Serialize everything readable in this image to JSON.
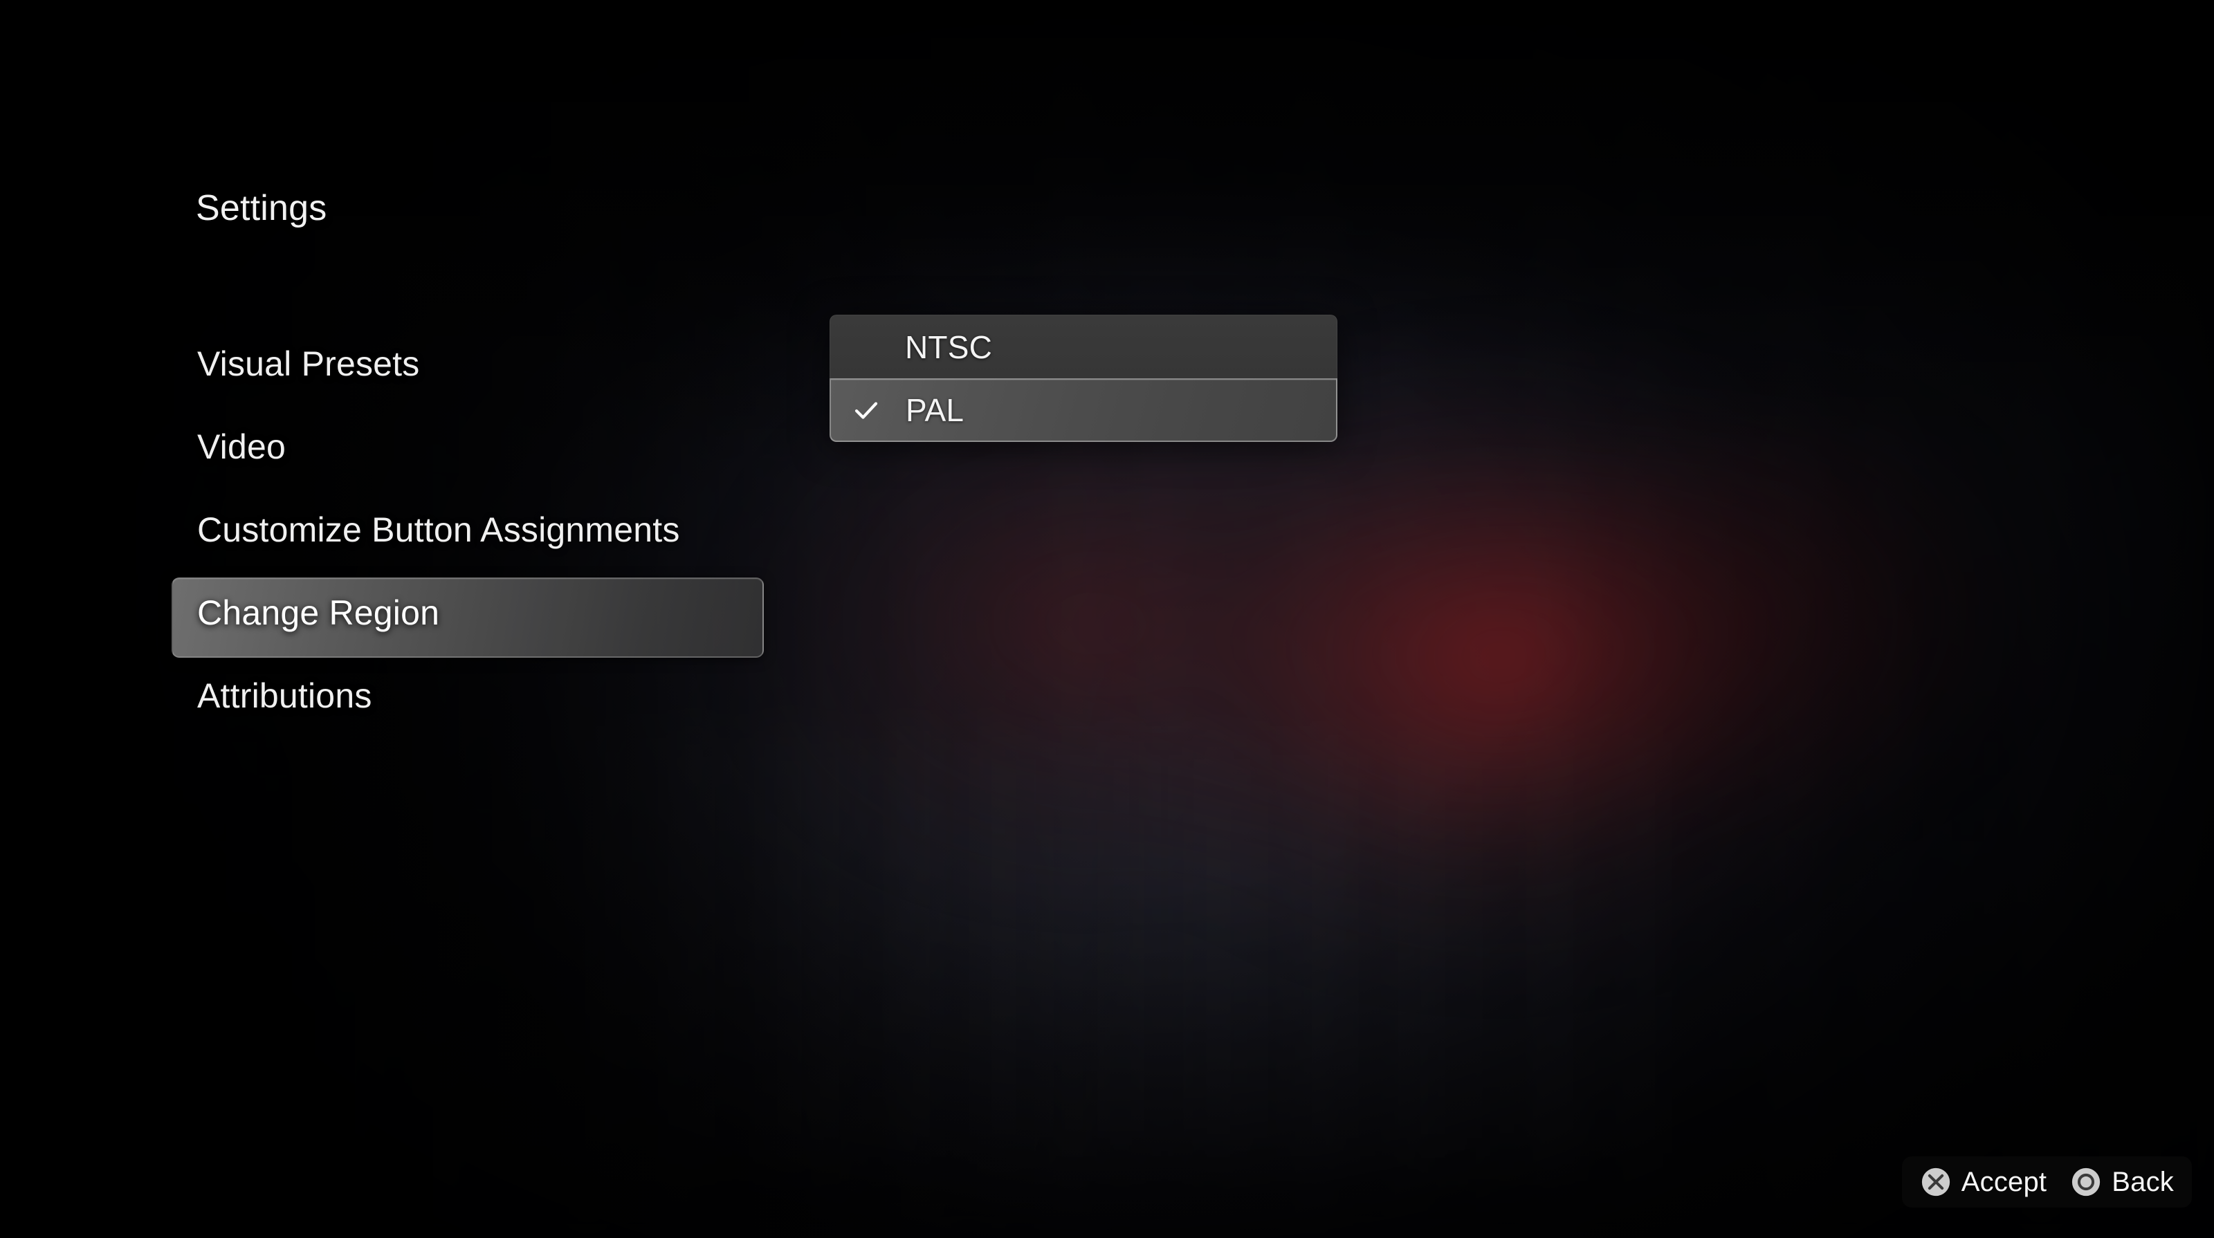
{
  "screen": {
    "title": "Settings",
    "background_description": "blurred dark game scene with red glow"
  },
  "colors": {
    "background": "#07070a",
    "red_glow": "#7a1616",
    "text_primary": "#f0f0f0",
    "selected_row_bg": "#6e6e6e",
    "dropdown_row_bg": "#363636",
    "dropdown_active_bg": "#4c4c4c",
    "prompt_bar_bg": "#080808",
    "prompt_icon_fill": "#c9c9c9"
  },
  "menu": {
    "items": [
      {
        "label": "Visual Presets",
        "selected": false
      },
      {
        "label": "Video",
        "selected": false
      },
      {
        "label": "Customize Button Assignments",
        "selected": false
      },
      {
        "label": "Change Region",
        "selected": true
      },
      {
        "label": "Attributions",
        "selected": false
      }
    ]
  },
  "dropdown": {
    "name": "Change Region",
    "selected_value": "PAL",
    "options": [
      {
        "label": "NTSC",
        "checked": false
      },
      {
        "label": "PAL",
        "checked": true
      }
    ]
  },
  "prompts": [
    {
      "icon": "playstation-cross-icon",
      "label": "Accept"
    },
    {
      "icon": "playstation-circle-icon",
      "label": "Back"
    }
  ]
}
